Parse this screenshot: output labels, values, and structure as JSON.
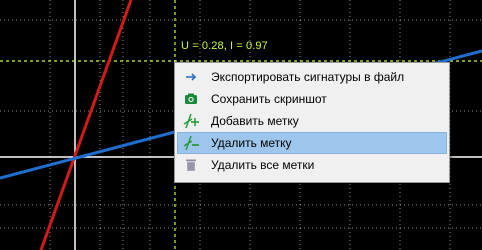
{
  "plot": {
    "readout": "U = 0.28, I = 0.97",
    "colors": {
      "background": "#000000",
      "grid": "#ffffff",
      "red_curve": "#d11a1a",
      "blue_curve": "#1e6fd0",
      "marker": "#c8ff3c"
    }
  },
  "context_menu": {
    "items": [
      {
        "label": "Экспортировать сигнатуры в файл",
        "icon": "export-arrow-icon",
        "highlighted": false
      },
      {
        "label": "Сохранить скриншот",
        "icon": "camera-icon",
        "highlighted": false
      },
      {
        "label": "Добавить метку",
        "icon": "add-marker-icon",
        "highlighted": false
      },
      {
        "label": "Удалить метку",
        "icon": "remove-marker-icon",
        "highlighted": true
      },
      {
        "label": "Удалить все метки",
        "icon": "trash-icon",
        "highlighted": false
      }
    ]
  }
}
